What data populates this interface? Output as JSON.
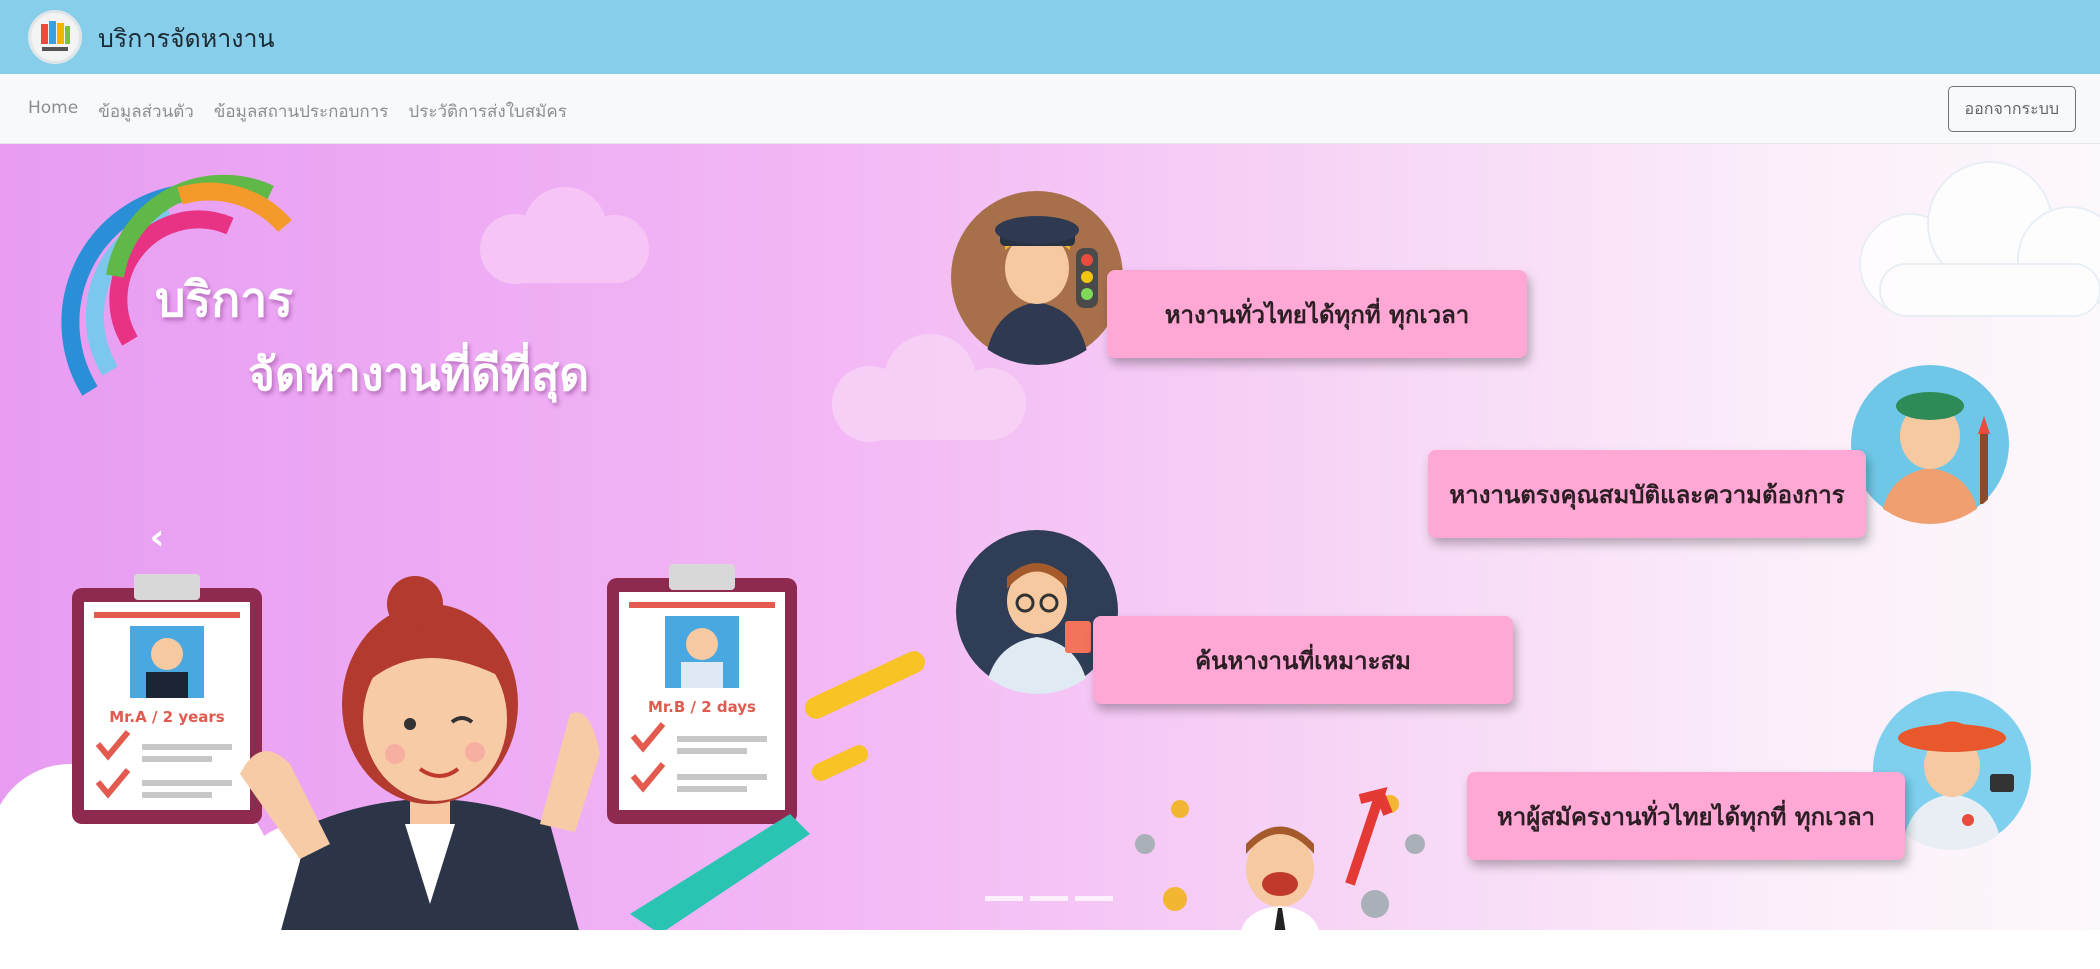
{
  "header": {
    "brand": "บริการจัดหางาน"
  },
  "nav": {
    "links": [
      "Home",
      "ข้อมูลส่วนตัว",
      "ข้อมูลสถานประกอบการ",
      "ประวัติการส่งใบสมัคร"
    ],
    "logout_label": "ออกจากระบบ"
  },
  "banner": {
    "title_line1": "บริการ",
    "title_line2": "จัดหางานที่ดีที่สุด",
    "bubbles": [
      "หางานทั่วไทยได้ทุกที่ ทุกเวลา",
      "หางานตรงคุณสมบัติและความต้องการ",
      "ค้นหางานที่เหมาะสม",
      "หาผู้สมัครงานทั่วไทยได้ทุกที่ ทุกเวลา"
    ],
    "board_a": "Mr.A / 2 years",
    "board_b": "Mr.B / 2 days",
    "prev_arrow": "‹"
  },
  "colors": {
    "header": "#87ceeb",
    "bubble": "#ffa7d5",
    "banner_left": "#e79cf2"
  },
  "icons": [
    "app-logo-icon",
    "chevron-left-icon",
    "check-icon",
    "dollar-coin-icon",
    "cloud-icon"
  ]
}
